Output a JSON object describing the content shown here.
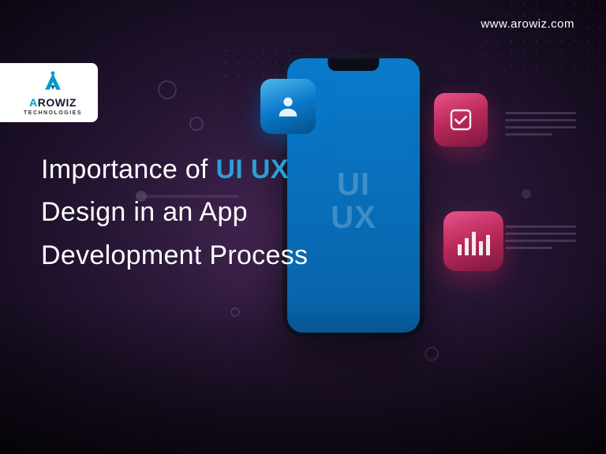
{
  "website_url": "www.arowiz.com",
  "logo": {
    "name": "AROWIZ",
    "subtitle": "TECHNOLOGIES"
  },
  "headline": {
    "part1": "Importance of ",
    "highlight": "UI UX",
    "part2": "Design in an App",
    "part3": "Development Process"
  },
  "phone_screen_text": {
    "line1": "UI",
    "line2": "UX"
  }
}
